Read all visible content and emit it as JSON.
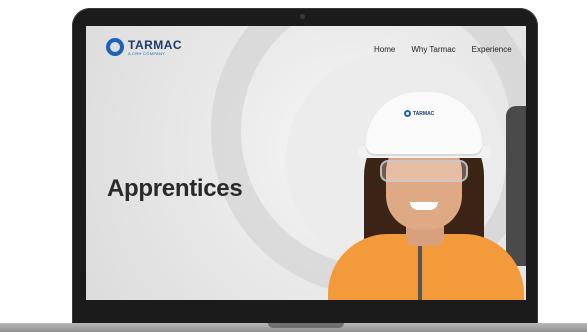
{
  "brand": {
    "name": "TARMAC",
    "tagline": "A CRH COMPANY",
    "accent": "#1e62b8"
  },
  "nav": {
    "items": [
      {
        "label": "Home"
      },
      {
        "label": "Why Tarmac"
      },
      {
        "label": "Experience"
      }
    ]
  },
  "hero": {
    "headline": "Apprentices",
    "helmet_logo": "TARMAC"
  }
}
